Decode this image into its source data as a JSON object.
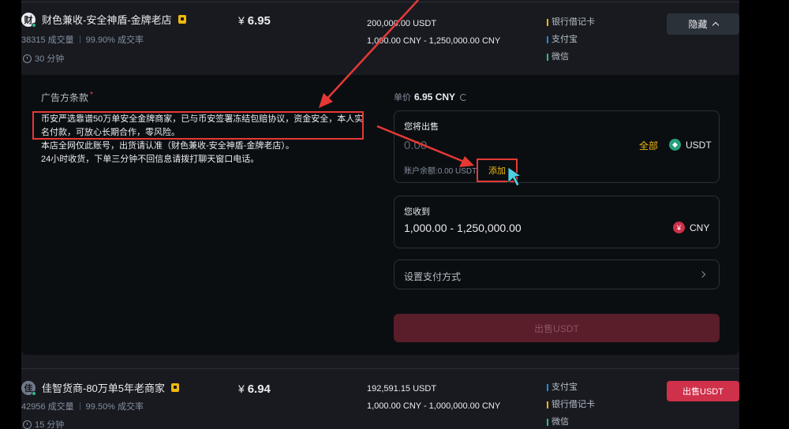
{
  "listing1": {
    "avatar_char": "财",
    "merchant_name": "财色兼收-安全神盾-金牌老店",
    "orders": "38315 成交量",
    "completion": "99.90% 成交率",
    "pay_time": "30 分钟",
    "currency_symbol": "¥",
    "price": "6.95",
    "available": "200,000.00 USDT",
    "limit": "1,000.00 CNY - 1,250,000.00 CNY",
    "payments": [
      {
        "label": "银行借记卡",
        "color": "#f0b90b"
      },
      {
        "label": "支付宝",
        "color": "#1e88e5"
      },
      {
        "label": "微信",
        "color": "#2ebd85"
      }
    ],
    "hide_label": "隐藏"
  },
  "panel": {
    "terms_title": "广告方条款",
    "required_mark": "*",
    "terms_lines": [
      "币安严选靠谱50万单安全金牌商家，已与币安签署冻结包赔协议，资金安全，本人实名付款，可放心长期合作，零风险。",
      "本店全网仅此账号，出货请认准（财色兼收-安全神盾-金牌老店）。",
      "24小时收货，下单三分钟不回信息请拨打聊天窗口电话。"
    ],
    "unit_price_label": "单价",
    "unit_price_value": "6.95 CNY",
    "sell_label": "您将出售",
    "sell_placeholder": "0.00",
    "all_label": "全部",
    "sell_coin": "USDT",
    "balance_label": "账户余额:0.00 USDT",
    "add_label": "添加",
    "receive_label": "您收到",
    "receive_amount": "1,000.00 - 1,250,000.00",
    "receive_coin": "CNY",
    "receive_coin_symbol": "¥",
    "payment_method_label": "设置支付方式",
    "sell_button": "出售USDT"
  },
  "listing2": {
    "avatar_char": "佳",
    "merchant_name": "佳智货商-80万单5年老商家",
    "orders": "42956 成交量",
    "completion": "99.50% 成交率",
    "pay_time": "15 分钟",
    "currency_symbol": "¥",
    "price": "6.94",
    "available": "192,591.15 USDT",
    "limit": "1,000.00 CNY - 1,000,000.00 CNY",
    "payments": [
      {
        "label": "支付宝",
        "color": "#1e88e5"
      },
      {
        "label": "银行借记卡",
        "color": "#f0b90b"
      },
      {
        "label": "微信",
        "color": "#2ebd85"
      }
    ],
    "sell_label": "出售USDT"
  },
  "colors": {
    "accent": "#f0b90b",
    "sell_red": "#cf304a",
    "annotation_red": "#e53935",
    "background": "#181a20"
  }
}
